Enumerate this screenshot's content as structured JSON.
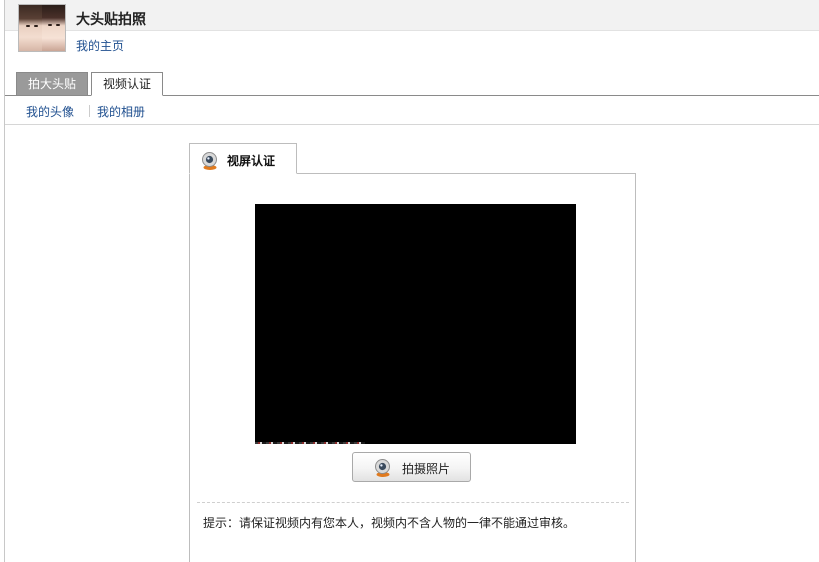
{
  "header": {
    "title": "大头贴拍照",
    "home_link": "我的主页",
    "avatar": "user-avatar-two-faces"
  },
  "tabs": [
    {
      "label": "拍大头贴",
      "active": false
    },
    {
      "label": "视频认证",
      "active": true
    }
  ],
  "subnav": {
    "items": [
      {
        "label": "我的头像"
      },
      {
        "label": "我的相册"
      }
    ]
  },
  "panel": {
    "tab_label": "视屏认证",
    "tab_icon": "webcam-icon",
    "capture_button": {
      "label": "拍摄照片",
      "icon": "webcam-icon"
    },
    "hint": "提示：请保证视频内有您本人，视频内不含人物的一律不能通过审核。"
  },
  "colors": {
    "link": "#1f4f8f",
    "inactive_tab": "#9a9a9a",
    "video_bg": "#000000",
    "border": "#bdbdbd"
  }
}
